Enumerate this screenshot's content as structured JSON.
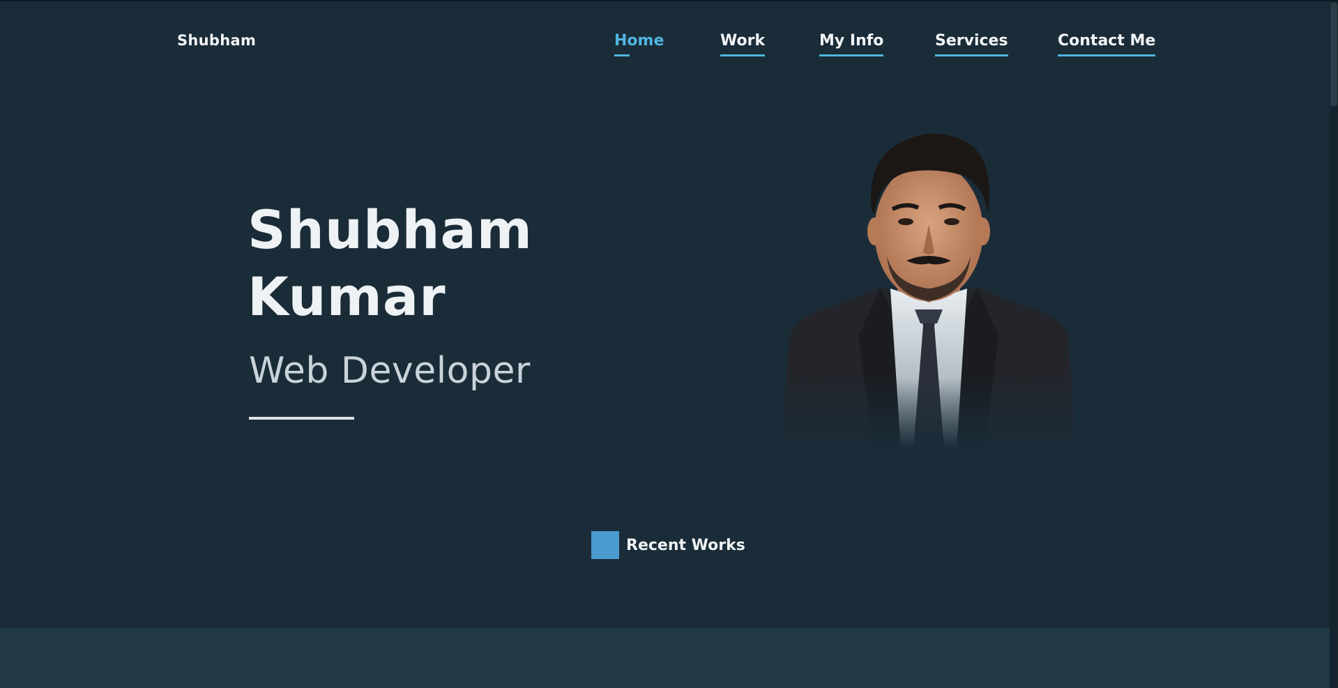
{
  "header": {
    "logo": "Shubham"
  },
  "nav": {
    "items": [
      {
        "label": "Home",
        "active": true
      },
      {
        "label": "Work",
        "active": false
      },
      {
        "label": "My Info",
        "active": false
      },
      {
        "label": "Services",
        "active": false
      },
      {
        "label": "Contact Me",
        "active": false
      }
    ]
  },
  "hero": {
    "first_name": "Shubham",
    "last_name": "Kumar",
    "role": "Web Developer"
  },
  "recent_works": {
    "label": "Recent Works"
  },
  "colors": {
    "background": "#1a2c38",
    "accent": "#4fb6e0",
    "band": "#213845"
  }
}
